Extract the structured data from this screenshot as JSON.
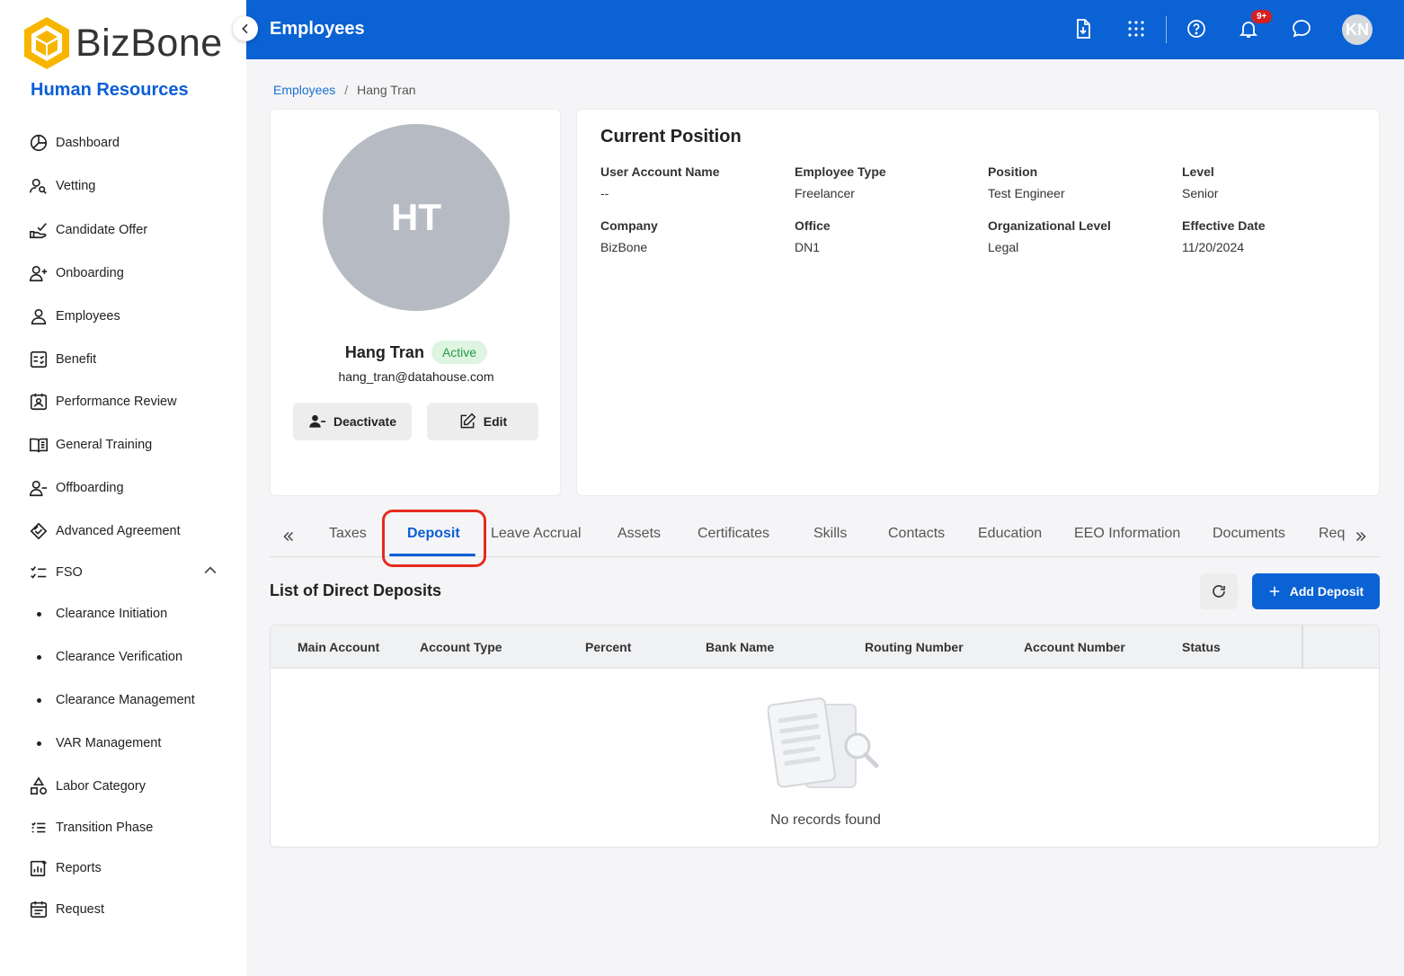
{
  "brand": {
    "name": "BizBone",
    "module": "Human Resources"
  },
  "sidebar": {
    "items": [
      {
        "label": "Dashboard",
        "icon": "dashboard-icon"
      },
      {
        "label": "Vetting",
        "icon": "vetting-icon"
      },
      {
        "label": "Candidate Offer",
        "icon": "offer-icon"
      },
      {
        "label": "Onboarding",
        "icon": "user-plus-icon"
      },
      {
        "label": "Employees",
        "icon": "user-icon"
      },
      {
        "label": "Benefit",
        "icon": "benefit-icon"
      },
      {
        "label": "Performance Review",
        "icon": "review-icon"
      },
      {
        "label": "General Training",
        "icon": "book-icon"
      },
      {
        "label": "Offboarding",
        "icon": "user-minus-icon"
      },
      {
        "label": "Advanced Agreement",
        "icon": "handshake-icon"
      },
      {
        "label": "FSO",
        "icon": "checklist-icon"
      },
      {
        "label": "Clearance Initiation"
      },
      {
        "label": "Clearance Verification"
      },
      {
        "label": "Clearance Management"
      },
      {
        "label": "VAR Management"
      },
      {
        "label": "Labor Category",
        "icon": "shapes-icon"
      },
      {
        "label": "Transition Phase",
        "icon": "list-icon"
      },
      {
        "label": "Reports",
        "icon": "report-icon"
      },
      {
        "label": "Request",
        "icon": "request-icon"
      }
    ]
  },
  "header": {
    "title": "Employees",
    "notif_count": "9+",
    "user_initials": "KN"
  },
  "breadcrumb": {
    "parent": "Employees",
    "separator": "/",
    "current": "Hang Tran"
  },
  "profile": {
    "initials": "HT",
    "name": "Hang Tran",
    "status": "Active",
    "email": "hang_tran@datahouse.com",
    "deactivate_label": "Deactivate",
    "edit_label": "Edit"
  },
  "position": {
    "title": "Current Position",
    "fields": [
      {
        "label": "User Account Name",
        "value": "--"
      },
      {
        "label": "Employee Type",
        "value": "Freelancer"
      },
      {
        "label": "Position",
        "value": "Test Engineer"
      },
      {
        "label": "Level",
        "value": "Senior"
      },
      {
        "label": "Company",
        "value": "BizBone"
      },
      {
        "label": "Office",
        "value": "DN1"
      },
      {
        "label": "Organizational Level",
        "value": "Legal"
      },
      {
        "label": "Effective Date",
        "value": "11/20/2024"
      }
    ]
  },
  "tabs": [
    "Taxes",
    "Deposit",
    "Leave Accrual",
    "Assets",
    "Certificates",
    "Skills",
    "Contacts",
    "Education",
    "EEO Information",
    "Documents",
    "Req"
  ],
  "deposits": {
    "title": "List of Direct Deposits",
    "add_label": "Add Deposit",
    "columns": [
      "Main Account",
      "Account Type",
      "Percent",
      "Bank Name",
      "Routing Number",
      "Account Number",
      "Status"
    ],
    "empty_text": "No records found"
  },
  "colors": {
    "primary": "#0a62d4",
    "highlight": "#e52b1e",
    "success": "#2a9a44"
  }
}
